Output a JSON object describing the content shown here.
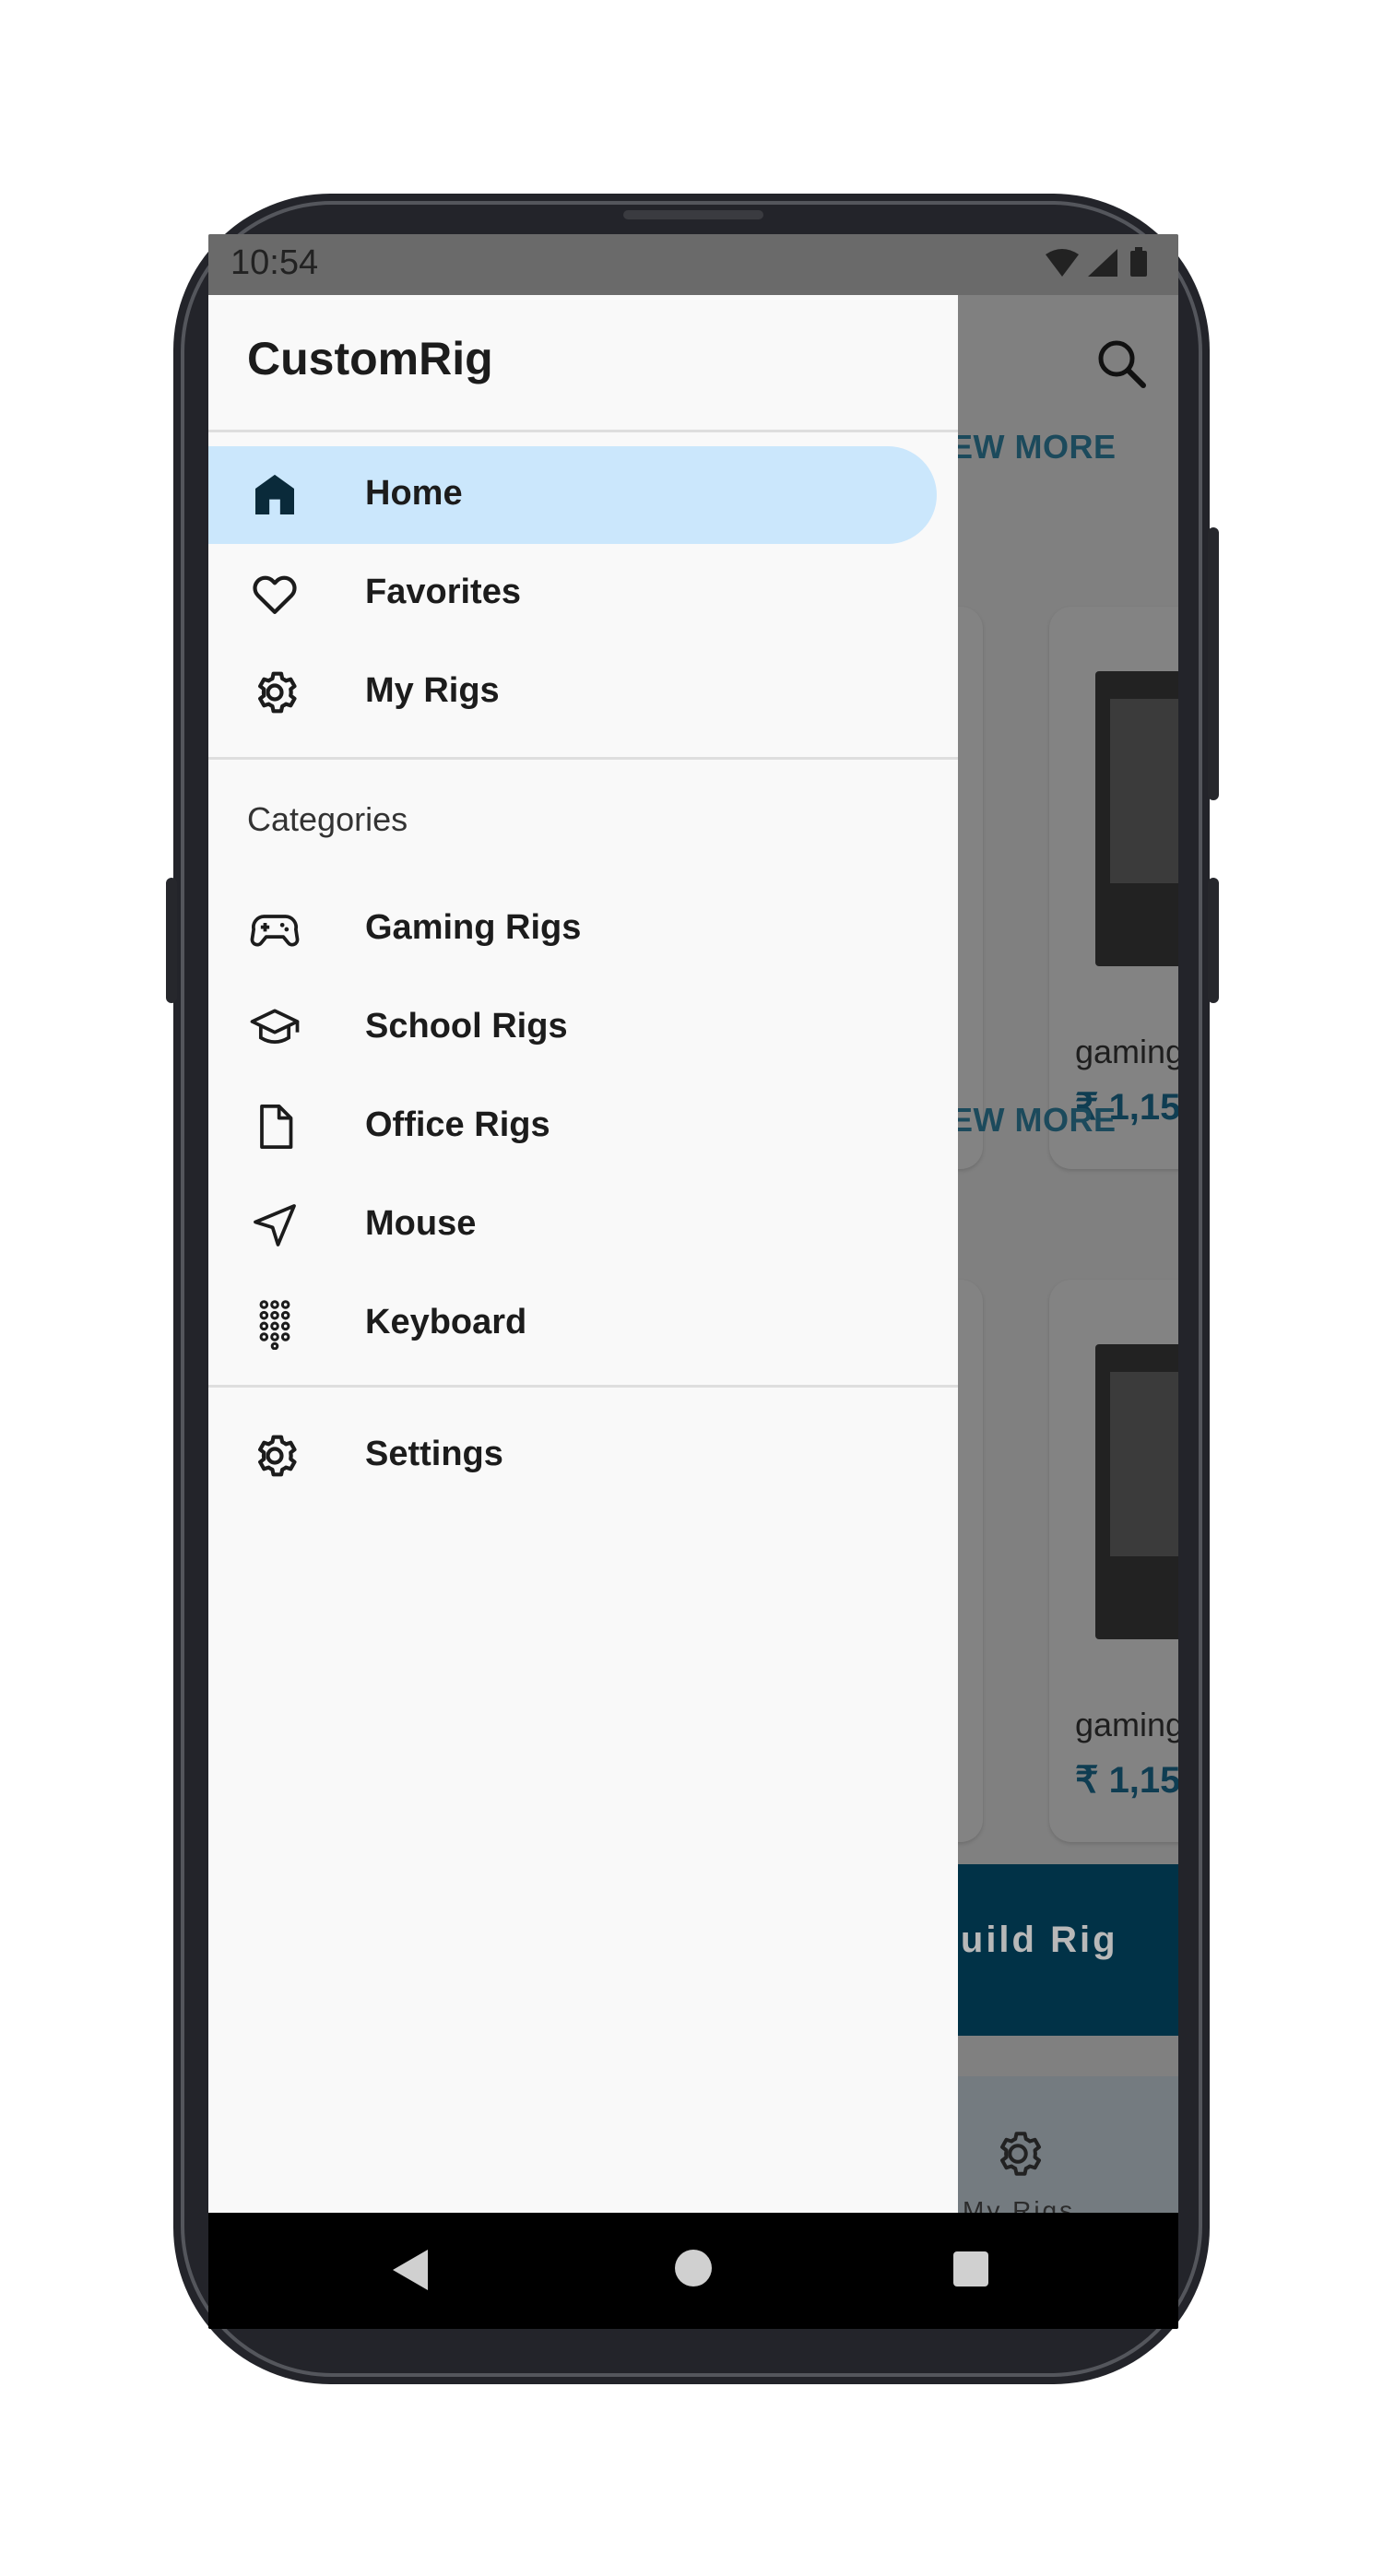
{
  "status_bar": {
    "time": "10:54"
  },
  "drawer": {
    "title": "CustomRig",
    "primary_items": [
      {
        "label": "Home",
        "icon": "home-icon",
        "active": true
      },
      {
        "label": "Favorites",
        "icon": "heart-icon",
        "active": false
      },
      {
        "label": "My Rigs",
        "icon": "gear-icon",
        "active": false
      }
    ],
    "categories_label": "Categories",
    "category_items": [
      {
        "label": "Gaming Rigs",
        "icon": "gamepad-icon"
      },
      {
        "label": "School Rigs",
        "icon": "graduation-cap-icon"
      },
      {
        "label": "Office Rigs",
        "icon": "document-icon"
      },
      {
        "label": "Mouse",
        "icon": "navigation-arrow-icon"
      },
      {
        "label": "Keyboard",
        "icon": "dialpad-icon"
      }
    ],
    "settings_label": "Settings"
  },
  "background": {
    "view_more_1": "VIEW MORE",
    "view_more_2": "VIEW MORE",
    "card1_name": "gaming",
    "card1_price": "₹ 1,15",
    "card2_name": "gaming",
    "card2_price": "₹ 1,15",
    "build_button": "Build Rig",
    "bottom_nav_label": "My Rigs"
  },
  "colors": {
    "active_item_bg": "#cbe7fc",
    "accent_dark": "#013247",
    "drawer_bg": "#f9f9f9"
  }
}
